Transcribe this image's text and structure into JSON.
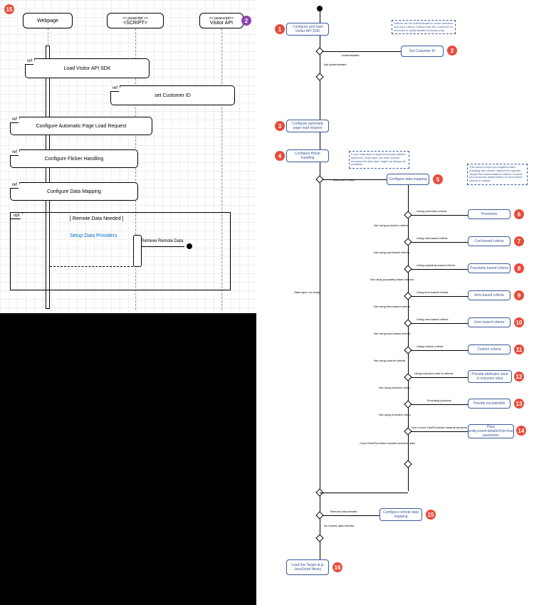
{
  "left": {
    "badge_main": "15",
    "badge_api": "2",
    "lifelines": {
      "webpage": "Webpage",
      "script_stereo": "<< javascript >>",
      "script_name": "<SCRIPT>",
      "api_stereo": "<< javascript>>",
      "api_name": "Visitor API"
    },
    "refs": {
      "load_sdk": "Load Visitor API SDK",
      "set_customer": "set Customer ID",
      "auto_page": "Configure Automatic Page Load Request",
      "flicker": "Configure Flicker Handling",
      "data_map": "Configure Data Mapping"
    },
    "ref_tag": "ref",
    "opt_tag": "opt",
    "opt_guard": "[ Remote Data Needed ]",
    "setup_providers": "Setup Data Providers",
    "retrieve_remote": "Retrieve Remote Data"
  },
  "right": {
    "nodes": {
      "n1": "Configure and load Visitor API SDK",
      "n2": "Set Customer ID",
      "n3": "Configure automatic page-load request",
      "n4": "Configure flicker handling",
      "n5": "Configure data mapping",
      "n6": "Promotion",
      "n7": "Cart-based criteria",
      "n8": "Popularity-based criteria",
      "n9": "Item-based criteria",
      "n10": "User-based criteria",
      "n11": "Custom criteria",
      "n12": "Provide attributes used in inclusion rules",
      "n13": "Provide excludedIds",
      "n14": "Pass entity.event.detailsOnly=true parameter",
      "n15": "Configure remote data mapping",
      "n16": "Load the Target at.js JavaScript library"
    },
    "notes": {
      "auth_note": "Visitors can be authenticated in some sessions and not in others. Ensure that Set Customer ID executes in authenticated sessions only.",
      "layer_note": "If your data layer is asynchronously loaded, follow the \"Data layer not read\" branch because the data layer might not always be available.",
      "branch_note": "This branch helps you augment data mapping with values required for specific Target Recommendations criteria. Consult your business stakeholders to know which criteria to enable."
    },
    "labels": {
      "authenticated": "Authenticated",
      "not_auth": "Not authenticated",
      "data_ready": "Data layer ready",
      "data_not_ready": "Data layer not ready",
      "using_promo": "Using promotion criteria",
      "not_promo": "Not using promotion criteria",
      "using_cart": "Using cart-based criteria",
      "not_cart": "Not using cart-based criteria",
      "using_pop": "Using popularity-based criteria",
      "not_pop": "Not using popularity-based criteria",
      "using_item": "Using item-based criteria",
      "not_item": "Not using item-based criteria",
      "using_user": "Using user-based criteria",
      "not_user": "Not using user-based criteria",
      "using_custom": "Using custom criteria",
      "not_custom": "Not using custom criteria",
      "using_incl": "Using inclusion rules in criteria",
      "not_incl": "Not using inclusion rules",
      "excl": "Excluding products",
      "not_excl": "Not using exclusion rules",
      "dont_count": "Don't count ViewPurchase towards behavior data",
      "count": "Count ViewPurchase towards behavior data",
      "remote_needed": "Remote data needed",
      "no_remote": "No remote data needed"
    },
    "badges": [
      "1",
      "2",
      "3",
      "4",
      "5",
      "6",
      "7",
      "8",
      "9",
      "10",
      "11",
      "12",
      "13",
      "14",
      "15",
      "16"
    ]
  }
}
